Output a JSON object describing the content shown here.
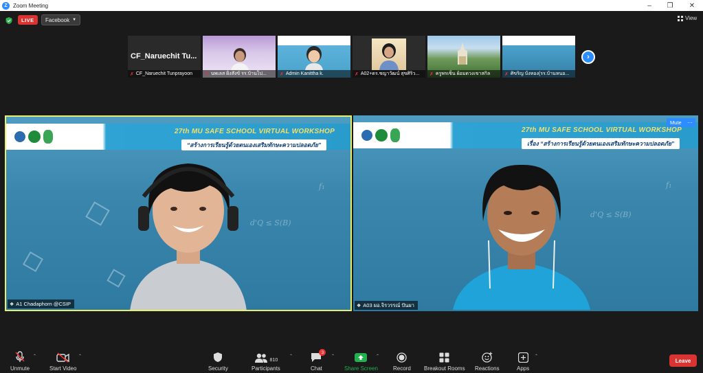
{
  "window": {
    "title": "Zoom Meeting",
    "logo_letter": "Z"
  },
  "topbar": {
    "live_label": "LIVE",
    "stream_target": "Facebook",
    "view_label": "View"
  },
  "thumbnails": [
    {
      "name": "CF_Naruechit Tunprayoon",
      "big_name": "CF_Naruechit  Tu..."
    },
    {
      "name": "นพเลส ฝั่งสังข์ รร.บ้านโป..."
    },
    {
      "name": "Admin Kanittha k."
    },
    {
      "name": "A02+ดร.ชญาวัฒน์ สุขศิริว..."
    },
    {
      "name": "ครูพรเซ็น ผ้อมดวงเขาสกิล"
    },
    {
      "name": "ศิขริญ บ้งหอง(รร.บ้านหนอ..."
    }
  ],
  "workshop": {
    "title": "27th MU SAFE SCHOOL VIRTUAL WORKSHOP",
    "subtitle_left": "“สร้างการเรียนรู้ด้วยตนเองเสริมทักษะความปลอดภัย”",
    "subtitle_right": "เรื่อง “สร้างการเรียนรู้ด้วยตนเองเสริมทักษะความปลอดภัย”"
  },
  "tiles": [
    {
      "name": "A1 Chadaphorn @CSIP"
    },
    {
      "name": "A03 ผอ.จิรวรรณ์ ปันผา",
      "mute_label": "Mute",
      "more_label": "···"
    }
  ],
  "toolbar": {
    "unmute": "Unmute",
    "start_video": "Start Video",
    "security": "Security",
    "participants": "Participants",
    "participants_count": "810",
    "chat": "Chat",
    "chat_badge": "3",
    "share_screen": "Share Screen",
    "record": "Record",
    "breakout_rooms": "Breakout Rooms",
    "reactions": "Reactions",
    "apps": "Apps",
    "leave": "Leave"
  },
  "colors": {
    "accent": "#2d8cff",
    "live": "#d93431",
    "active_border": "#e8f06a",
    "share_green": "#22b14c"
  }
}
